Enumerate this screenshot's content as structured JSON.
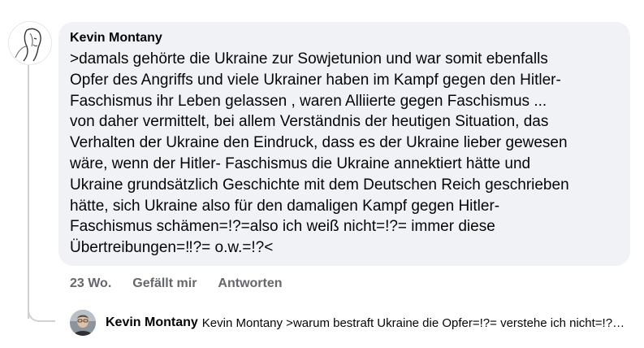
{
  "comment": {
    "author": "Kevin Montany",
    "text": ">damals gehörte die Ukraine zur Sowjetunion und war somit ebenfalls\nOpfer des Angriffs und viele Ukrainer haben im Kampf gegen den Hitler-\nFaschismus ihr Leben gelassen , waren Alliierte gegen Faschismus ...\nvon daher vermittelt, bei allem Verständnis der heutigen Situation, das\nVerhalten der Ukraine den Eindruck, dass es der Ukraine lieber gewesen\nwäre, wenn der Hitler- Faschismus die Ukraine annektiert hätte und\nUkraine grundsätzlich Geschichte mit dem Deutschen Reich geschrieben\nhätte, sich Ukraine  also für den damaligen Kampf gegen Hitler-\nFaschismus schämen=!?=also ich weiß nicht=!?= immer diese\nÜbertreibungen=‼?=  o.w.=!?<",
    "time": "23 Wo.",
    "like_label": "Gefällt mir",
    "reply_label": "Antworten"
  },
  "reply_preview": {
    "author": "Kevin Montany",
    "text": "Kevin Montany >warum bestraft Ukraine die Opfer=!?= verstehe ich nicht=!?= sie müssten doch stolz auf ihre Vorfahren sein"
  },
  "icons": {
    "main_avatar": "sketch-portrait-avatar",
    "reply_avatar": "photo-portrait-avatar"
  }
}
